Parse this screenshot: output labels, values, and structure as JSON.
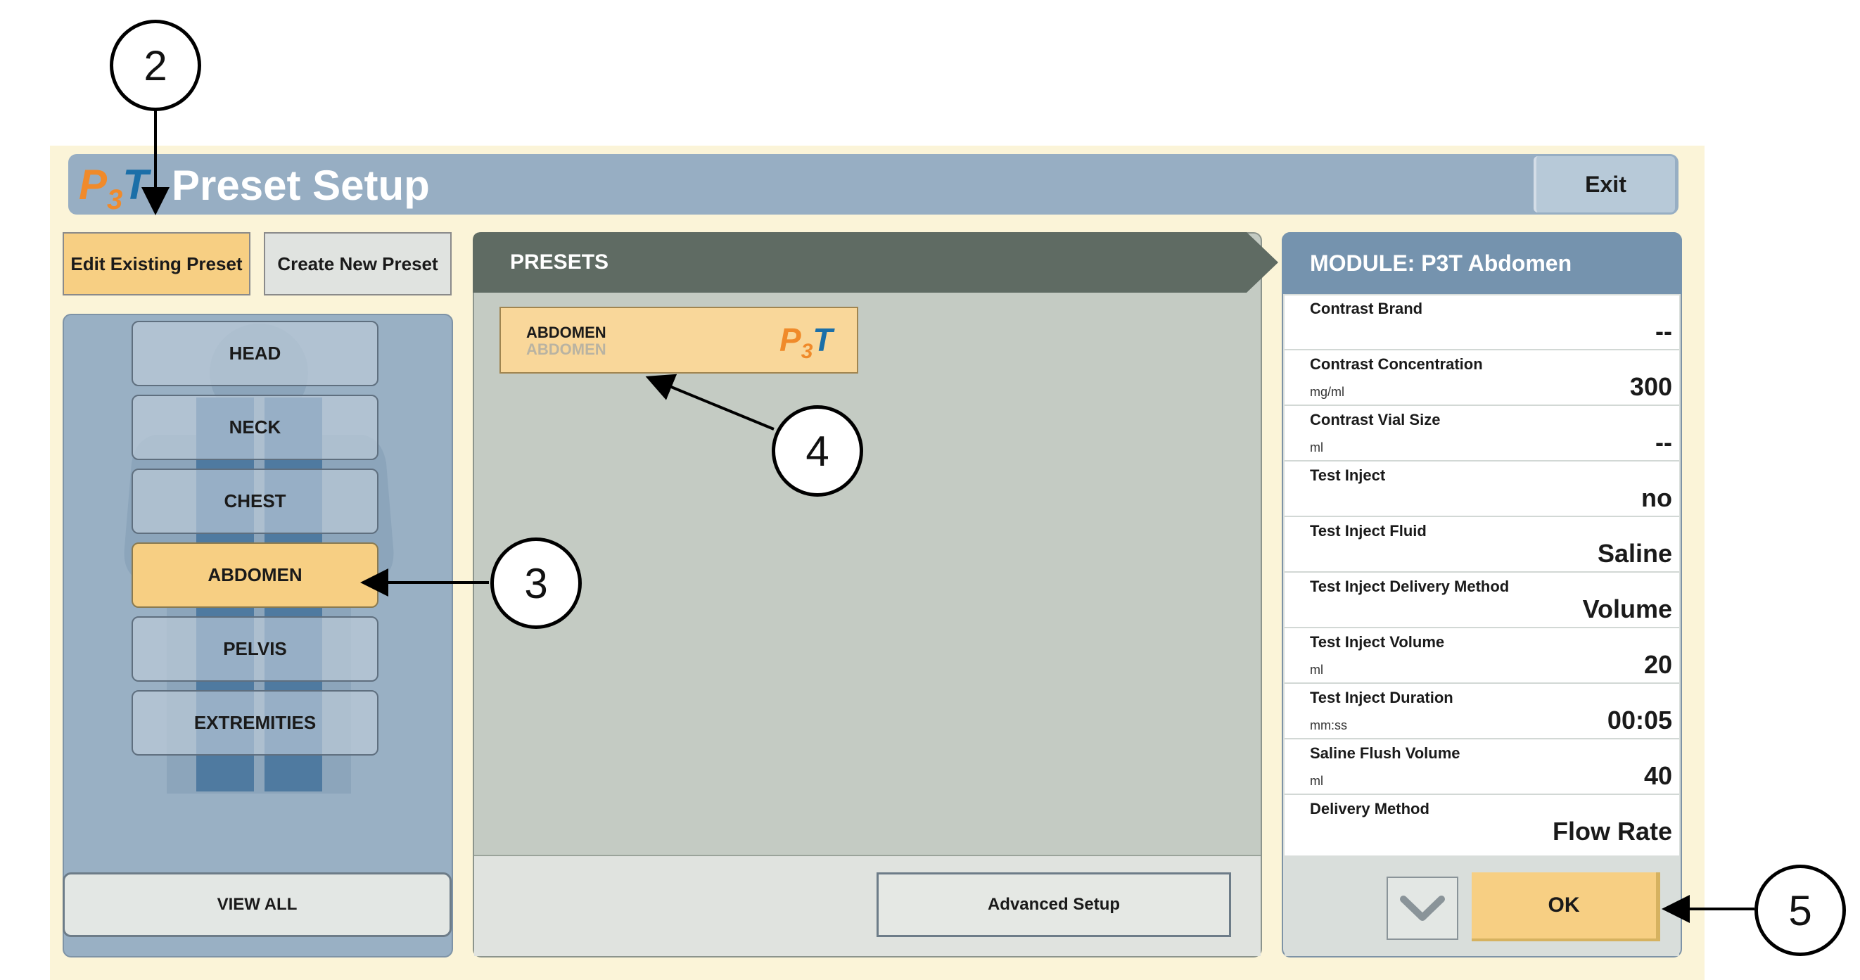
{
  "header": {
    "logo": {
      "p": "P",
      "n": "3",
      "t": "T"
    },
    "title": "Preset Setup",
    "exit_label": "Exit"
  },
  "tabs": {
    "edit_label": "Edit Existing Preset",
    "create_label": "Create New Preset"
  },
  "regions": {
    "items": [
      "HEAD",
      "NECK",
      "CHEST",
      "ABDOMEN",
      "PELVIS",
      "EXTREMITIES"
    ],
    "selected": "ABDOMEN",
    "view_all_label": "VIEW ALL"
  },
  "presets": {
    "header": "PRESETS",
    "card": {
      "name": "ABDOMEN",
      "sub": "ABDOMEN",
      "logo": {
        "p": "P",
        "n": "3",
        "t": "T"
      }
    },
    "advanced_label": "Advanced Setup"
  },
  "module": {
    "title": "MODULE: P3T Abdomen",
    "fields": [
      {
        "label": "Contrast Brand",
        "unit": "",
        "value": "--"
      },
      {
        "label": "Contrast Concentration",
        "unit": "mg/ml",
        "value": "300"
      },
      {
        "label": "Contrast Vial Size",
        "unit": "ml",
        "value": "--"
      },
      {
        "label": "Test Inject",
        "unit": "",
        "value": "no"
      },
      {
        "label": "Test Inject Fluid",
        "unit": "",
        "value": "Saline"
      },
      {
        "label": "Test Inject Delivery Method",
        "unit": "",
        "value": "Volume"
      },
      {
        "label": "Test Inject Volume",
        "unit": "ml",
        "value": "20"
      },
      {
        "label": "Test Inject Duration",
        "unit": "mm:ss",
        "value": "00:05"
      },
      {
        "label": "Saline Flush Volume",
        "unit": "ml",
        "value": "40"
      },
      {
        "label": "Delivery Method",
        "unit": "",
        "value": "Flow Rate"
      }
    ],
    "ok_label": "OK"
  },
  "callouts": {
    "c2": "2",
    "c3": "3",
    "c4": "4",
    "c5": "5"
  },
  "colors": {
    "accent": "#f7cf83",
    "titlebar": "#97aec3",
    "presets_header": "#5f6b63",
    "module_header": "#7593ae"
  }
}
